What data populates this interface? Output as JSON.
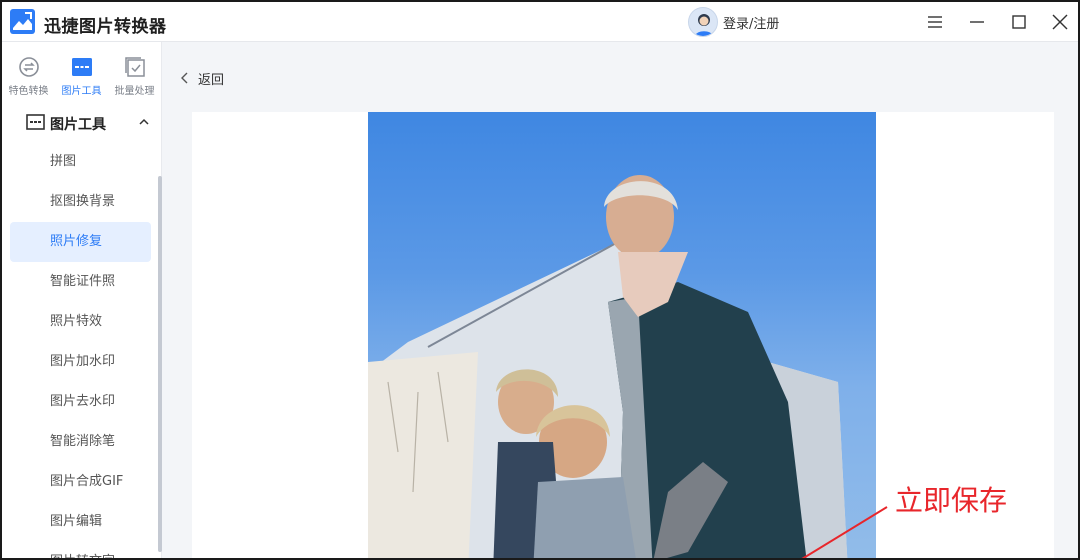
{
  "app": {
    "title": "迅捷图片转换器"
  },
  "header": {
    "login_label": "登录/注册"
  },
  "sidebar": {
    "top_tabs": [
      {
        "label": "特色转换",
        "icon": "convert-icon"
      },
      {
        "label": "图片工具",
        "icon": "image-tools-icon"
      },
      {
        "label": "批量处理",
        "icon": "batch-icon"
      }
    ],
    "section_title": "图片工具",
    "items": [
      {
        "label": "拼图"
      },
      {
        "label": "抠图换背景"
      },
      {
        "label": "照片修复"
      },
      {
        "label": "智能证件照"
      },
      {
        "label": "照片特效"
      },
      {
        "label": "图片加水印"
      },
      {
        "label": "图片去水印"
      },
      {
        "label": "智能消除笔"
      },
      {
        "label": "图片合成GIF"
      },
      {
        "label": "图片编辑"
      },
      {
        "label": "图片转文字"
      }
    ],
    "active_item": "照片修复"
  },
  "main": {
    "back_label": "返回",
    "annotation": "立即保存"
  },
  "colors": {
    "accent": "#2d7cf6",
    "annotation": "#e8262b",
    "active_bg": "#e5efff"
  }
}
